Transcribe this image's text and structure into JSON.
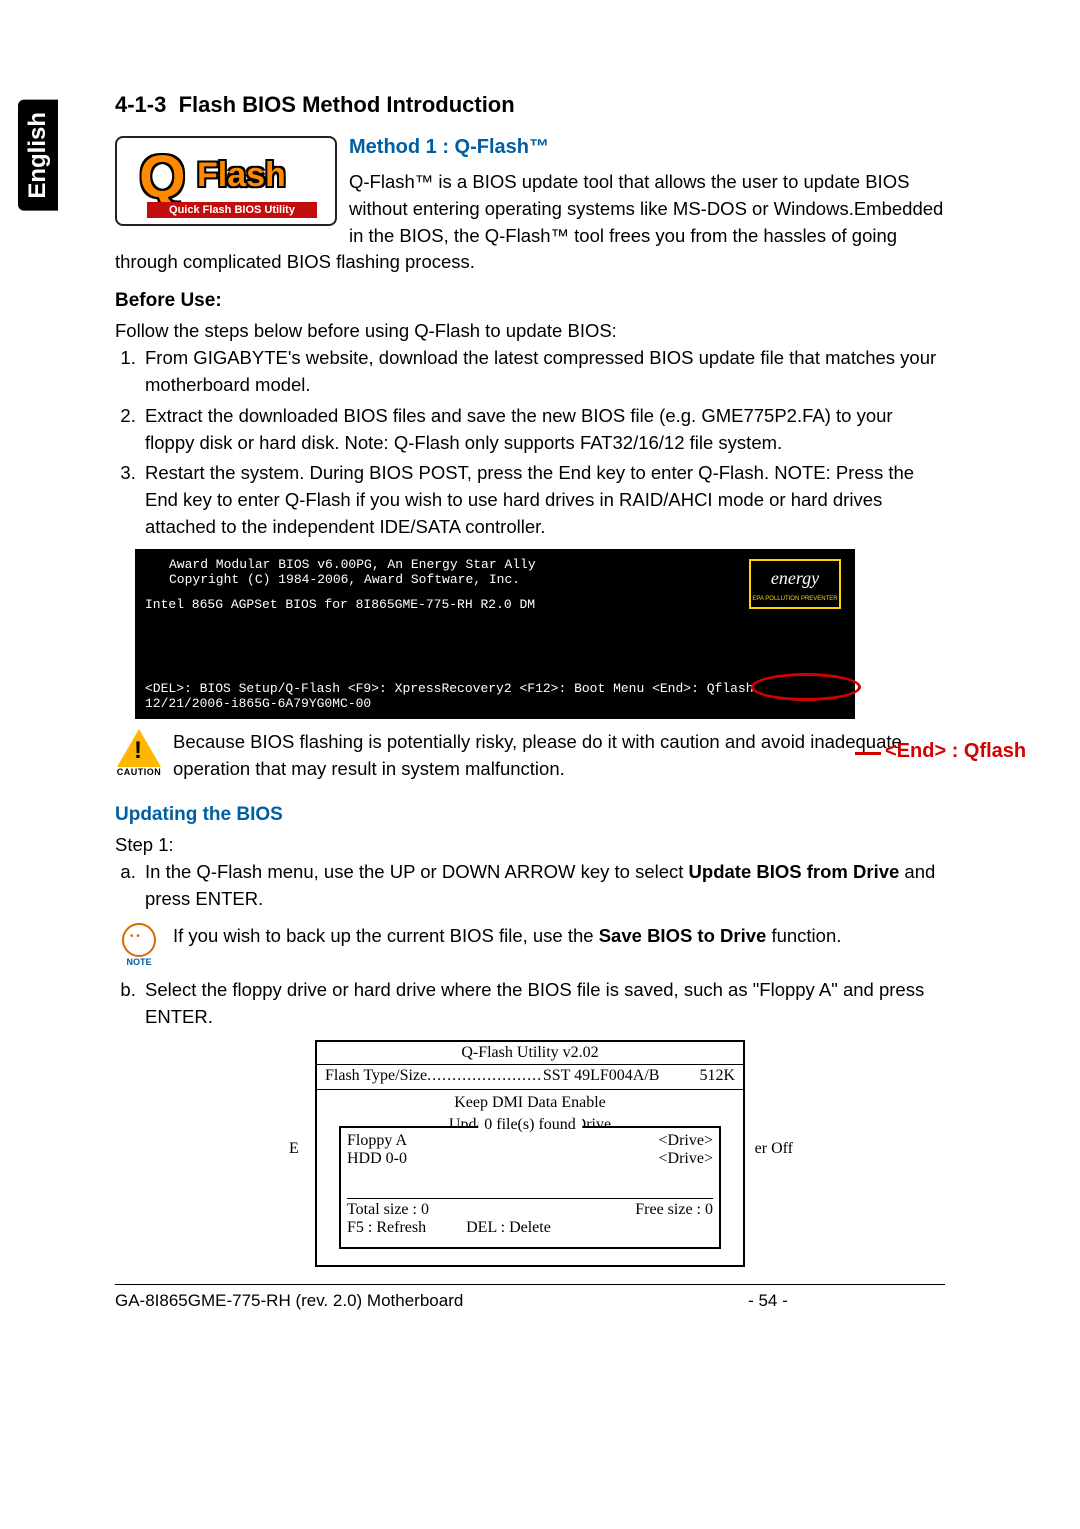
{
  "sidebar": {
    "language": "English"
  },
  "section": {
    "number": "4-1-3",
    "title": "Flash BIOS Method Introduction"
  },
  "logo": {
    "q": "Q",
    "flash": "Flash",
    "bar": "Quick Flash BIOS Utility"
  },
  "method1": {
    "title": "Method 1 : Q-Flash™",
    "intro": "Q-Flash™ is a BIOS update tool that allows the user to update BIOS without entering operating systems like MS-DOS or Windows.Embedded in the BIOS, the Q-Flash™ tool frees you from the hassles of going through complicated BIOS flashing process."
  },
  "before": {
    "heading": "Before Use:",
    "lead": "Follow the steps below before using Q-Flash to update BIOS:",
    "steps": [
      "From GIGABYTE's website, download the latest compressed BIOS update file that matches your motherboard model.",
      "Extract the downloaded BIOS files and save the new BIOS file (e.g. GME775P2.FA) to your floppy disk or hard disk. Note: Q-Flash only supports FAT32/16/12 file system.",
      "Restart the system. During BIOS POST, press the End key to enter Q-Flash.  NOTE: Press the End key to enter Q-Flash if you wish to use hard drives in RAID/AHCI mode or hard drives attached to the independent IDE/SATA controller."
    ]
  },
  "bios": {
    "line1": "Award Modular BIOS v6.00PG, An Energy Star Ally",
    "line2": "Copyright (C) 1984-2006, Award Software, Inc.",
    "line3": "Intel 865G AGPSet BIOS for 8I865GME-775-RH R2.0 DM",
    "energy_text": "energy",
    "energy_sub": "EPA  POLLUTION PREVENTER",
    "bottom1": "<DEL>: BIOS Setup/Q-Flash  <F9>: XpressRecovery2  <F12>: Boot Menu  <End>: Qflash",
    "bottom2": "12/21/2006-i865G-6A79YG0MC-00",
    "callout": "<End> : Qflash"
  },
  "caution": {
    "label": "CAUTION",
    "text": "Because BIOS flashing is potentially risky, please do it with caution and avoid inadequate operation that may result in system malfunction."
  },
  "updating": {
    "heading": "Updating the BIOS",
    "step1_label": "Step 1:",
    "a_pre": "In the Q-Flash menu, use the UP or DOWN ARROW key to select ",
    "a_bold": "Update BIOS from Drive",
    "a_post": " and press ENTER.",
    "note_label": "NOTE",
    "note_pre": "If you wish to back up the current BIOS file, use the ",
    "note_bold": "Save BIOS to Drive",
    "note_post": " function.",
    "b": "Select the floppy drive or hard drive where the BIOS file is saved, such as \"Floppy A\" and press ENTER."
  },
  "util": {
    "title": "Q-Flash Utility v2.02",
    "flash_type_label": "Flash Type/Size",
    "flash_type_value": "SST 49LF004A/B",
    "flash_size": "512K",
    "dmi": "Keep DMI Data   Enable",
    "update_line": "Update BIOS from Drive",
    "files_found": "0 file(s) found",
    "floppy": "Floppy A",
    "hdd": "HDD 0-0",
    "drive_tag": "<Drive>",
    "left_marker": "E",
    "right_marker": "er Off",
    "total": "Total size : 0",
    "free": "Free size : 0",
    "f5": "F5 : Refresh",
    "del": "DEL : Delete"
  },
  "footer": {
    "model": "GA-8I865GME-775-RH (rev. 2.0) Motherboard",
    "page": "- 54 -"
  }
}
